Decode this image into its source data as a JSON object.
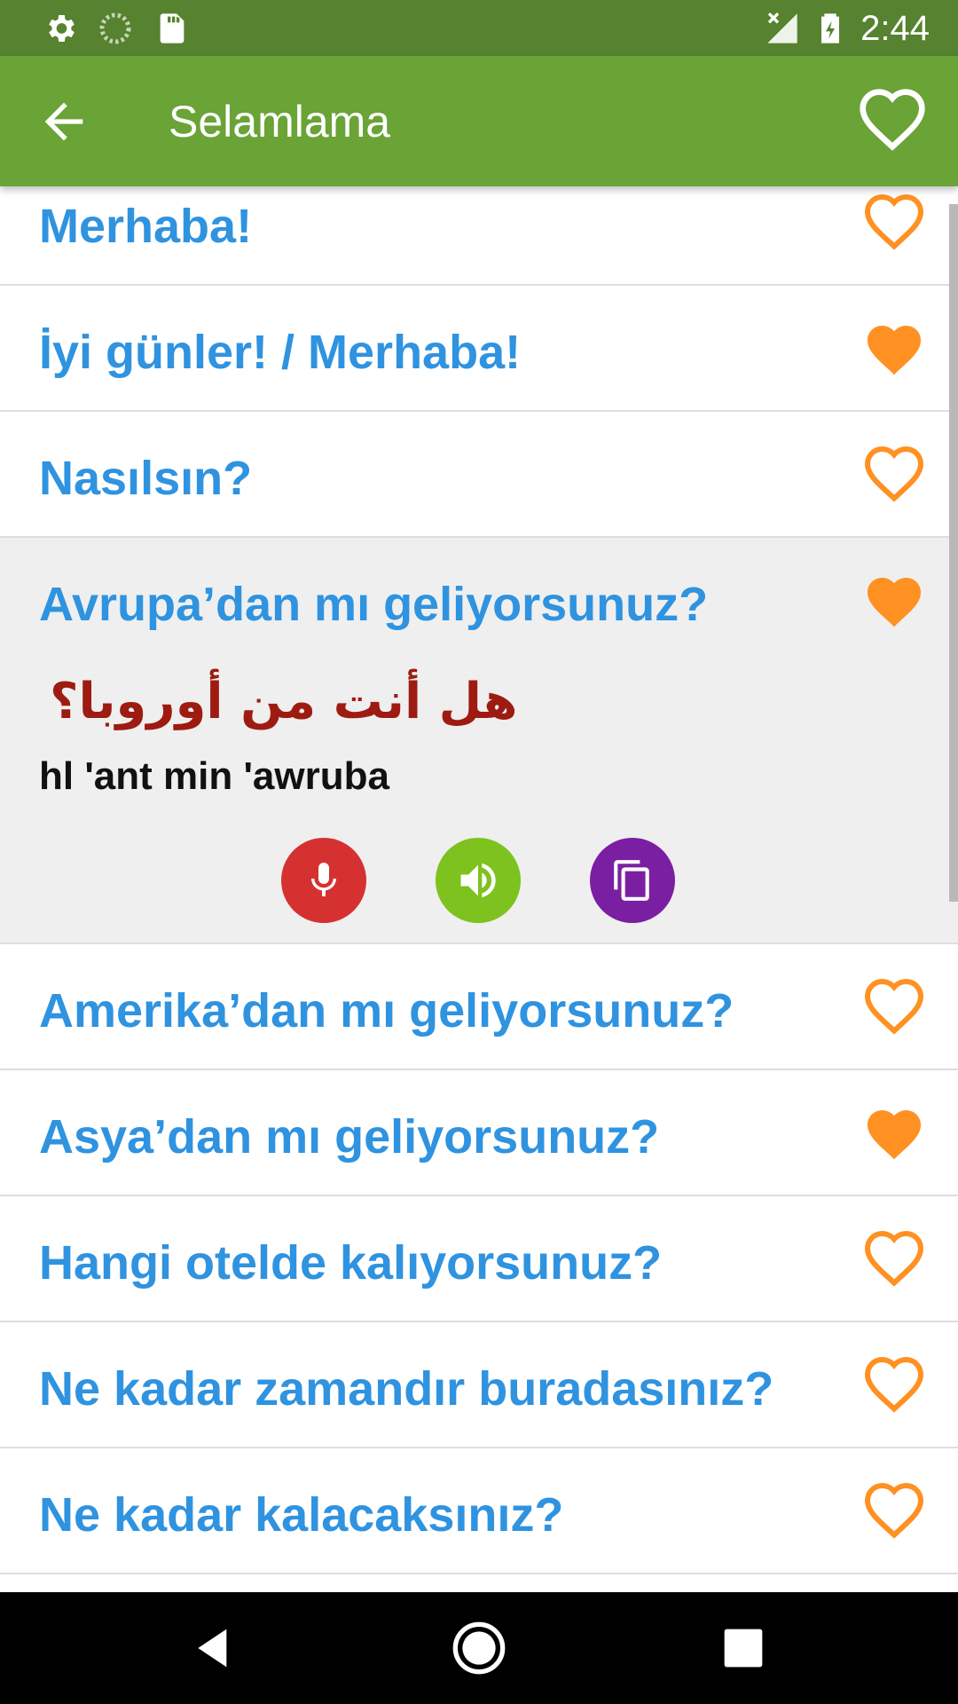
{
  "status_bar": {
    "time": "2:44",
    "icons": [
      "gear-icon",
      "sync-icon",
      "sd-card-icon",
      "signal-icon",
      "battery-charging-icon"
    ]
  },
  "app_bar": {
    "title": "Selamlama",
    "back_icon": "arrow-left-icon",
    "favorite_icon": "heart-outline-icon"
  },
  "colors": {
    "status_bar": "#578230",
    "app_bar": "#6aa336",
    "phrase_text": "#2f93e0",
    "heart": "#ff9122",
    "arabic_text": "#9e1b12",
    "mic_button": "#d63131",
    "speaker_button": "#7dc21e",
    "copy_button": "#7b1fa2"
  },
  "phrases": [
    {
      "text": "Merhaba!",
      "favorite": false
    },
    {
      "text": "İyi günler! / Merhaba!",
      "favorite": true
    },
    {
      "text": "Nasılsın?",
      "favorite": false
    },
    {
      "text": "Avrupa’dan mı geliyorsunuz?",
      "favorite": true
    },
    {
      "text": "Amerika’dan mı geliyorsunuz?",
      "favorite": false
    },
    {
      "text": "Asya’dan mı geliyorsunuz?",
      "favorite": true
    },
    {
      "text": "Hangi otelde kalıyorsunuz?",
      "favorite": false
    },
    {
      "text": "Ne kadar zamandır buradasınız?",
      "favorite": false
    },
    {
      "text": "Ne kadar kalacaksınız?",
      "favorite": false
    }
  ],
  "expanded": {
    "arabic": "هل أنت من أوروبا؟",
    "transliteration": "hl 'ant min 'awruba",
    "actions": [
      "microphone-icon",
      "speaker-icon",
      "copy-icon"
    ]
  },
  "nav_bar": {
    "icons": [
      "back-triangle-icon",
      "home-circle-icon",
      "recents-square-icon"
    ]
  }
}
